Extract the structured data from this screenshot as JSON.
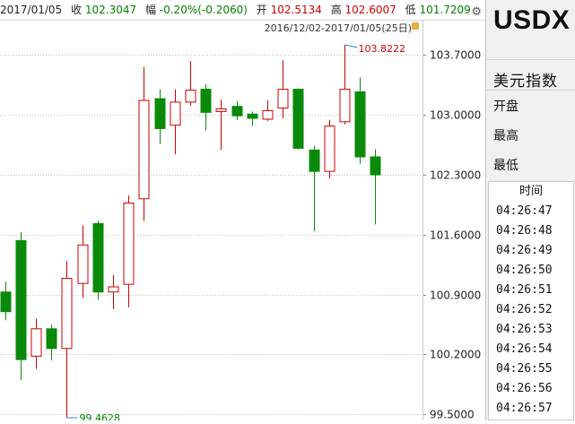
{
  "header": {
    "date": "2017/01/05",
    "close_label": "收",
    "close_value": "102.3047",
    "change_label": "幅",
    "change_value": "-0.20%(-0.2060)",
    "open_label": "开",
    "open_value": "102.5134",
    "high_label": "高",
    "high_value": "102.6007",
    "low_label": "低",
    "low_value": "101.7209"
  },
  "chart": {
    "range_label": "2016/12/02-2017/01/05(25日)",
    "max_label": "103.8222",
    "min_label": "99.4628"
  },
  "chart_data": {
    "type": "candlestick",
    "y_ticks": [
      "103.7000",
      "103.0000",
      "102.3000",
      "101.6000",
      "100.9000",
      "100.2000",
      "99.5000"
    ],
    "ylim": [
      99.45,
      104.05
    ],
    "candles": [
      {
        "o": 100.93,
        "c": 100.7,
        "h": 101.05,
        "l": 100.6
      },
      {
        "o": 101.53,
        "c": 100.14,
        "h": 101.63,
        "l": 99.9
      },
      {
        "o": 100.18,
        "c": 100.5,
        "h": 100.62,
        "l": 100.03
      },
      {
        "o": 100.5,
        "c": 100.27,
        "h": 100.55,
        "l": 100.13
      },
      {
        "o": 100.27,
        "c": 101.09,
        "h": 101.29,
        "l": 99.46
      },
      {
        "o": 101.03,
        "c": 101.48,
        "h": 101.71,
        "l": 100.86
      },
      {
        "o": 101.73,
        "c": 100.93,
        "h": 101.76,
        "l": 100.84
      },
      {
        "o": 100.93,
        "c": 100.99,
        "h": 101.13,
        "l": 100.73
      },
      {
        "o": 101.02,
        "c": 101.97,
        "h": 102.06,
        "l": 100.75
      },
      {
        "o": 102.02,
        "c": 103.17,
        "h": 103.56,
        "l": 101.76
      },
      {
        "o": 103.19,
        "c": 102.84,
        "h": 103.3,
        "l": 102.66
      },
      {
        "o": 102.88,
        "c": 103.15,
        "h": 103.3,
        "l": 102.54
      },
      {
        "o": 103.15,
        "c": 103.29,
        "h": 103.63,
        "l": 103.11
      },
      {
        "o": 103.3,
        "c": 103.03,
        "h": 103.36,
        "l": 102.82
      },
      {
        "o": 103.04,
        "c": 103.07,
        "h": 103.18,
        "l": 102.59
      },
      {
        "o": 103.1,
        "c": 102.99,
        "h": 103.16,
        "l": 102.94
      },
      {
        "o": 103.01,
        "c": 102.96,
        "h": 103.04,
        "l": 102.87
      },
      {
        "o": 102.95,
        "c": 103.05,
        "h": 103.17,
        "l": 102.93
      },
      {
        "o": 103.08,
        "c": 103.3,
        "h": 103.64,
        "l": 102.96
      },
      {
        "o": 103.3,
        "c": 102.61,
        "h": 103.31,
        "l": 102.6
      },
      {
        "o": 102.59,
        "c": 102.34,
        "h": 102.64,
        "l": 101.64
      },
      {
        "o": 102.34,
        "c": 102.87,
        "h": 102.94,
        "l": 102.26
      },
      {
        "o": 102.92,
        "c": 103.3,
        "h": 103.82,
        "l": 102.89
      },
      {
        "o": 103.27,
        "c": 102.51,
        "h": 103.44,
        "l": 102.43
      },
      {
        "o": 102.51,
        "c": 102.3,
        "h": 102.6,
        "l": 101.72
      }
    ],
    "up_color": "#cc0000",
    "down_color": "#0a8a0a"
  },
  "sidebar": {
    "symbol": "USDX",
    "name": "美元指数",
    "quote_labels": [
      "开盘",
      "最高",
      "最低"
    ],
    "time_header": "时间",
    "times": [
      "04:26:47",
      "04:26:48",
      "04:26:49",
      "04:26:50",
      "04:26:51",
      "04:26:52",
      "04:26:53",
      "04:26:54",
      "04:26:55",
      "04:26:56",
      "04:26:57"
    ]
  }
}
